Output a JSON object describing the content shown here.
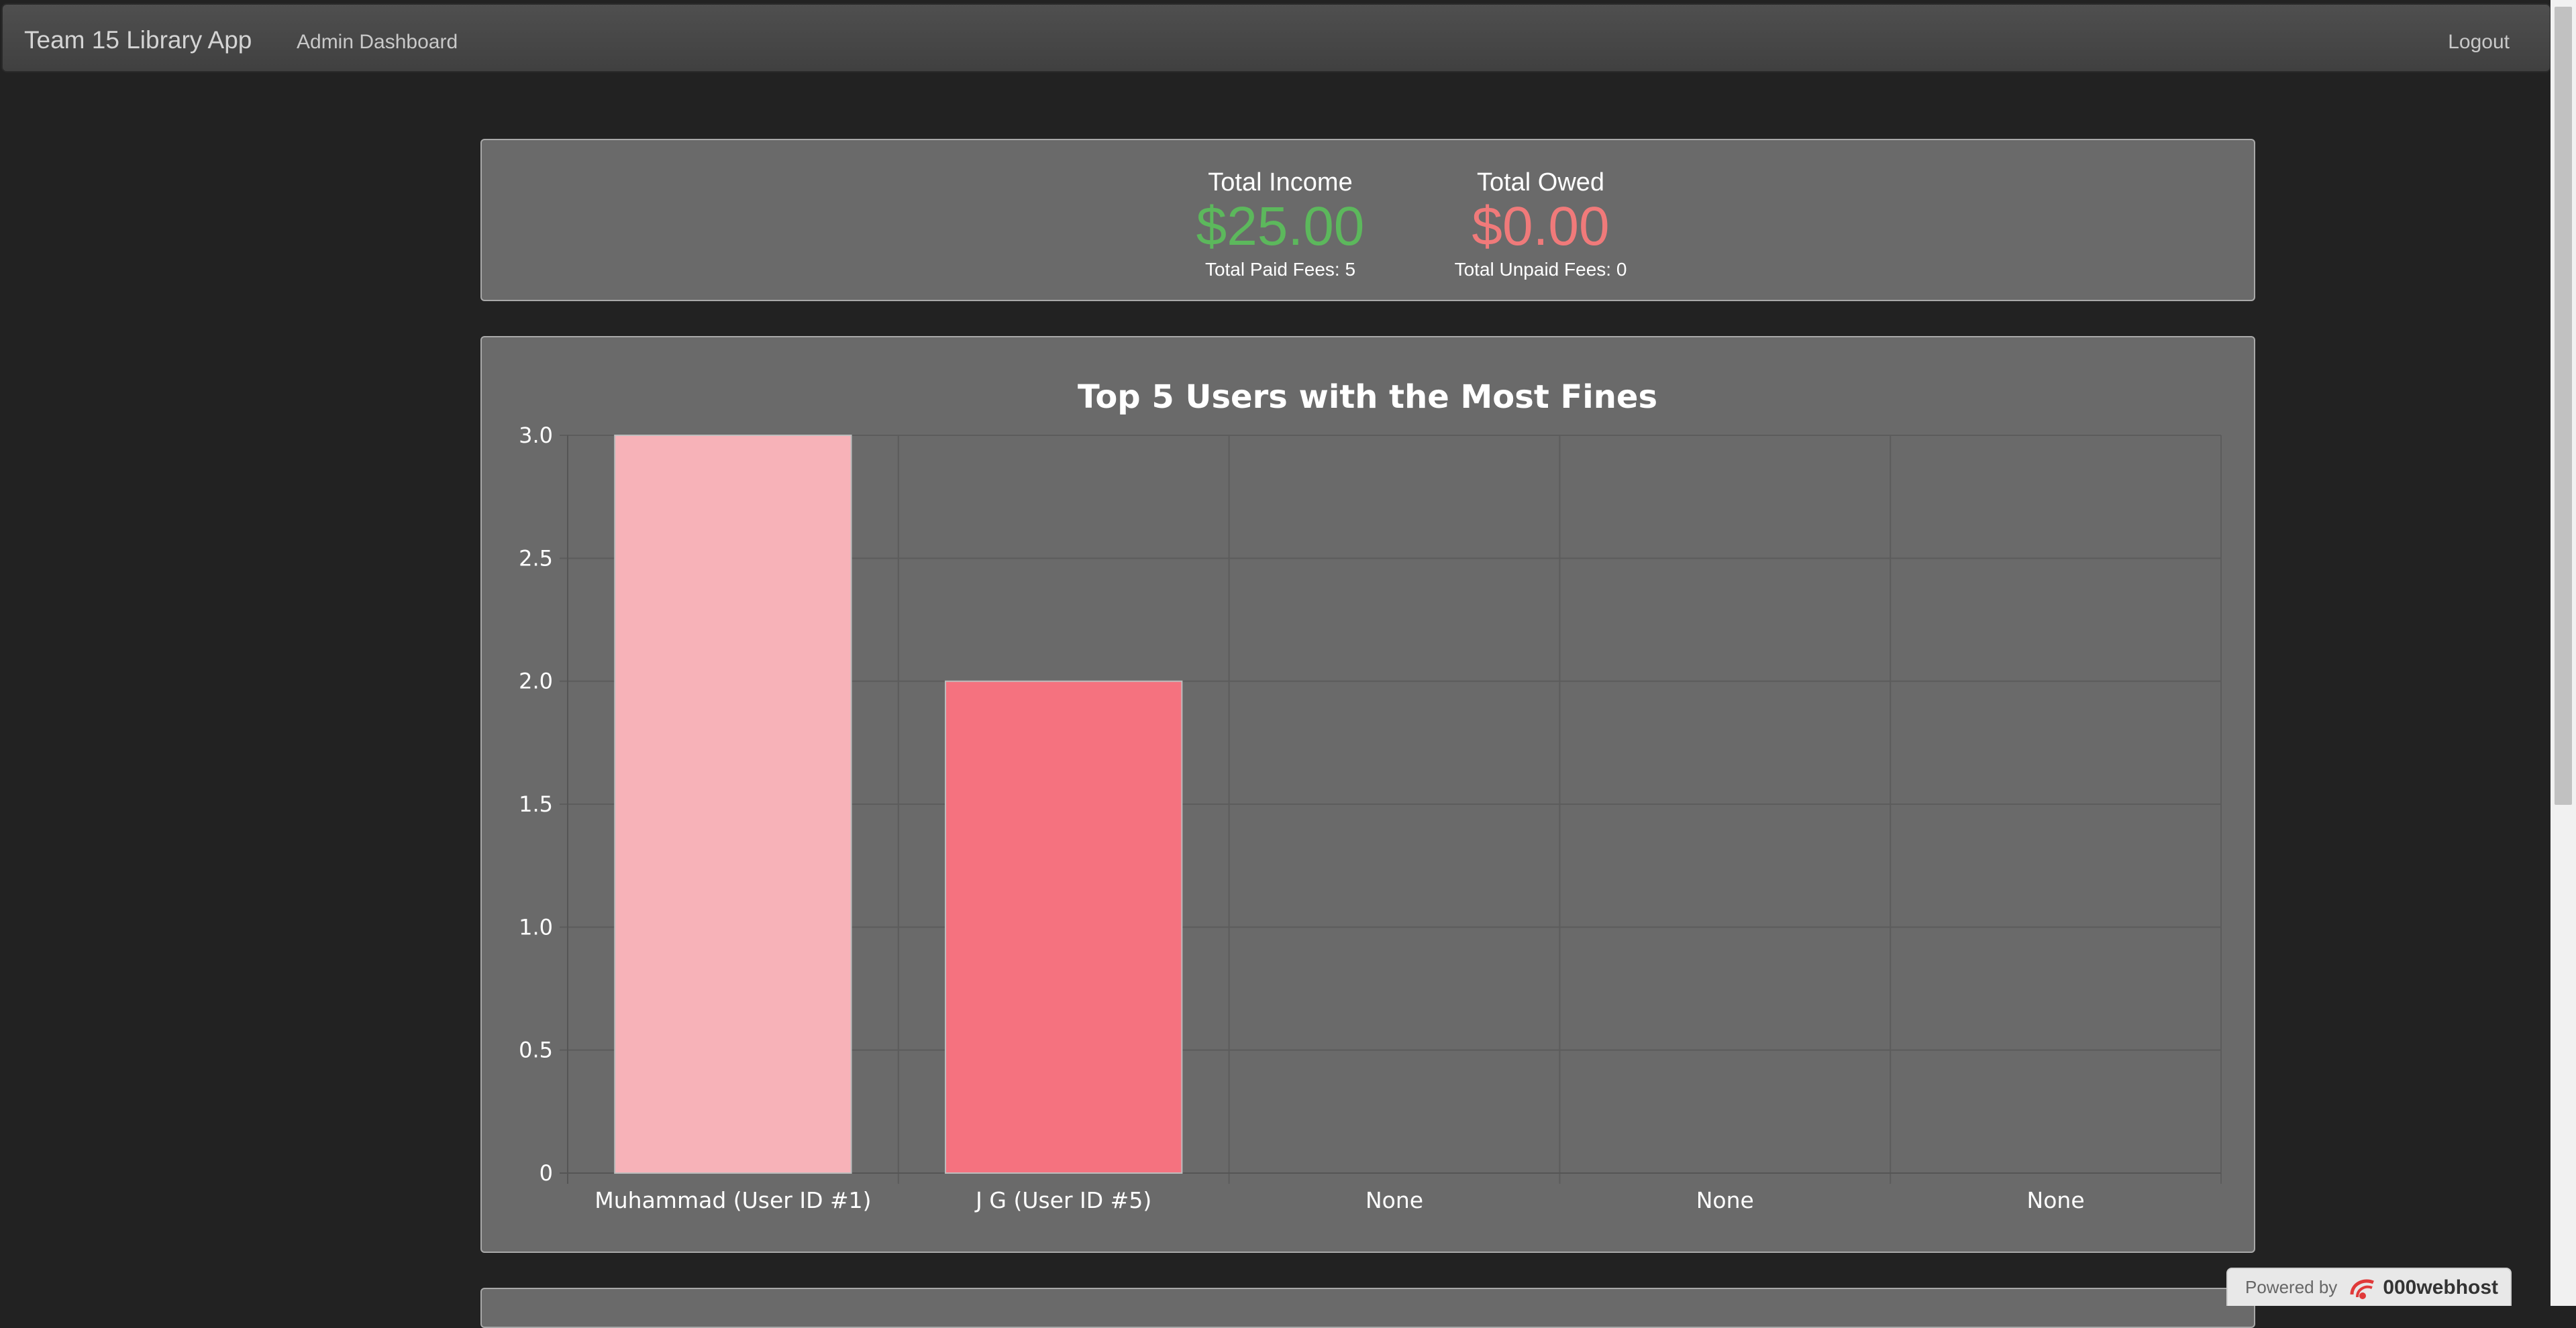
{
  "navbar": {
    "brand": "Team 15 Library App",
    "admin_link": "Admin Dashboard",
    "logout": "Logout"
  },
  "stats": {
    "income": {
      "label": "Total Income",
      "value": "$25.00",
      "sub": "Total Paid Fees: 5",
      "color": "#5cb85c"
    },
    "owed": {
      "label": "Total Owed",
      "value": "$0.00",
      "sub": "Total Unpaid Fees: 0",
      "color": "#f07a7a"
    }
  },
  "chart_data": {
    "type": "bar",
    "title": "Top 5 Users with the Most Fines",
    "categories": [
      "Muhammad (User ID #1)",
      "J G (User ID #5)",
      "None",
      "None",
      "None"
    ],
    "values": [
      3,
      2,
      0,
      0,
      0
    ],
    "colors": [
      "#f7b2b8",
      "#f5727f",
      "#f5727f",
      "#f5727f",
      "#f5727f"
    ],
    "ylim": [
      0,
      3
    ],
    "yticks": [
      "3.0",
      "2.5",
      "2.0",
      "1.5",
      "1.0",
      "0.5",
      "0"
    ],
    "grid": true,
    "legend": "none"
  },
  "footer": {
    "powered_by": "Powered by",
    "host": "000webhost"
  }
}
